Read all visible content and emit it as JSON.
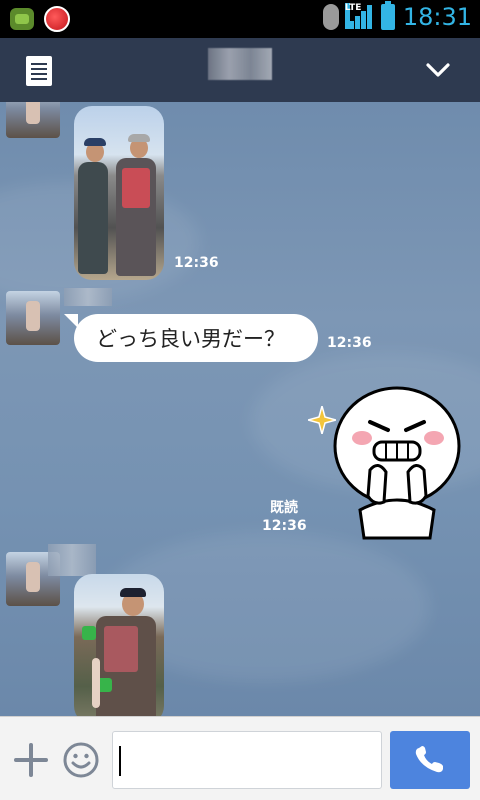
{
  "statusbar": {
    "network": "LTE",
    "time": "18:31",
    "icons": [
      "android-debug-icon",
      "red-app-icon",
      "bluetooth-icon",
      "lte-signal-icon",
      "battery-charging-icon"
    ]
  },
  "header": {
    "title": "",
    "left_icon": "notes-icon",
    "right_icon": "chevron-down-icon"
  },
  "messages": [
    {
      "type": "photo",
      "time": "12:36"
    },
    {
      "type": "text",
      "text": "どっち良い男だー？",
      "time": "12:36"
    },
    {
      "type": "sticker",
      "read_label": "既読",
      "time": "12:36"
    },
    {
      "type": "photo"
    }
  ],
  "composer": {
    "value": "",
    "plus_icon": "plus-icon",
    "emoji_icon": "smiley-icon",
    "call_icon": "phone-icon"
  },
  "colors": {
    "header_bg": "#2e3a50",
    "status_accent": "#33b5e5",
    "call_button": "#4d84de",
    "chat_bg": "#7591b0"
  }
}
